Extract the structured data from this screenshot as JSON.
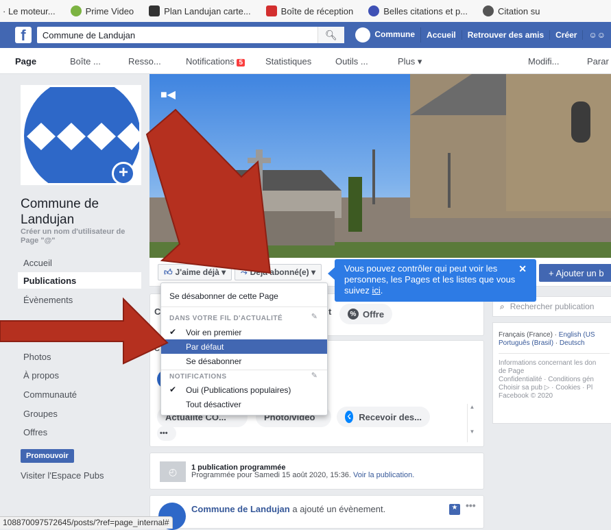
{
  "bookmarks": [
    "· Le moteur...",
    "Prime Video",
    "Plan Landujan carte...",
    "Boîte de réception",
    "Belles citations et p...",
    "Citation su"
  ],
  "fbbar": {
    "search_value": "Commune de Landujan",
    "nav": [
      "Commune",
      "Accueil",
      "Retrouver des amis",
      "Créer"
    ]
  },
  "tabs": {
    "page": "Page",
    "boite": "Boîte ...",
    "resso": "Resso...",
    "notifications": "Notifications",
    "notif_count": "5",
    "statistiques": "Statistiques",
    "outils": "Outils ...",
    "plus": "Plus ▾",
    "modifi": "Modifi...",
    "param": "Parar"
  },
  "left": {
    "page_name": "Commune de Landujan",
    "username_hint": "Créer un nom d'utilisateur de Page \"@\"",
    "nav": [
      "Accueil",
      "Publications",
      "Évènements",
      "Photos",
      "À propos",
      "Communauté",
      "Groupes",
      "Offres"
    ],
    "promo": "Promouvoir",
    "visit": "Visiter l'Espace Pubs"
  },
  "actionbar": {
    "like": "J'aime déjà ▾",
    "follow": "Déjà abonné(e) ▾",
    "add": "+ Ajouter un b"
  },
  "tooltip": {
    "text": "Vous pouvez contrôler qui peut voir les personnes, les Pages et les listes que vous suivez ",
    "link": "ici",
    "end": "."
  },
  "dropdown": {
    "unfollow_page": "Se désabonner de cette Page",
    "feed_header": "DANS VOTRE FIL D'ACTUALITÉ",
    "see_first": "Voir en premier",
    "default": "Par défaut",
    "unfollow": "Se désabonner",
    "notif_header": "NOTIFICATIONS",
    "notif_on": "Oui (Publications populaires)",
    "notif_off": "Tout désactiver"
  },
  "composer": {
    "t_letter": "t",
    "offre": "Offre",
    "c_letter": "C",
    "actualite": "Actualité CO...",
    "photovideo": "Photo/vidéo",
    "recevoir": "Recevoir des...",
    "more": "•••"
  },
  "scheduled": {
    "title": "1 publication programmée",
    "detail": "Programmée pour Samedi 15 août 2020, 15:36.",
    "link": "Voir la publication."
  },
  "post": {
    "author": "Commune de Landujan",
    "action": "a ajouté un évènement.",
    "more": "•••"
  },
  "right": {
    "search_placeholder": "Rechercher publication",
    "lang_current": "Français (France)",
    "lang_en": "English (US",
    "lang_pt": "Português (Brasil)",
    "lang_de": "Deutsch",
    "info1": "Informations concernant les don",
    "info2": "de Page",
    "info3": "Confidentialité · Conditions gén",
    "info4": "Choisir sa pub ▷ · Cookies · Pl",
    "info5": "Facebook © 2020"
  },
  "status_url": "108870097572645/posts/?ref=page_internal#",
  "colors": {
    "fb_blue": "#4267b2",
    "tooltip": "#2d7be5",
    "arrow": "#b5301f"
  }
}
